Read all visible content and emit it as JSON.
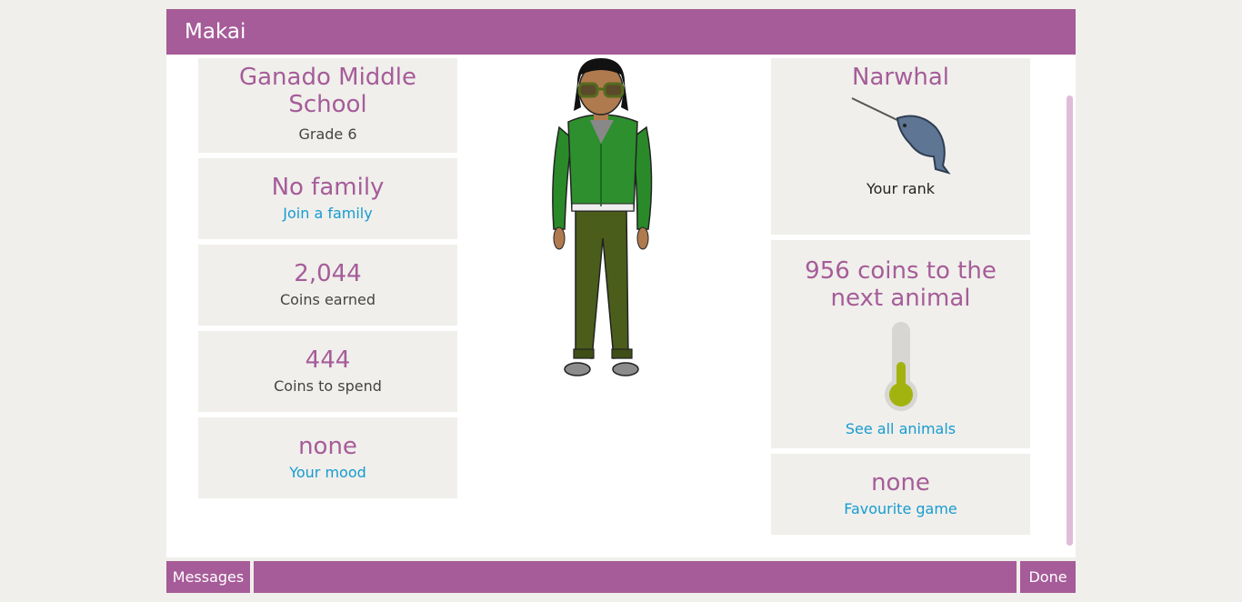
{
  "window": {
    "title": "Makai"
  },
  "left": {
    "school": {
      "name": "Ganado Middle School",
      "grade": "Grade 6"
    },
    "family": {
      "value": "No family",
      "link": "Join a family"
    },
    "earned": {
      "value": "2,044",
      "label": "Coins earned"
    },
    "spend": {
      "value": "444",
      "label": "Coins to spend"
    },
    "mood": {
      "value": "none",
      "link": "Your mood"
    }
  },
  "right": {
    "rank": {
      "animal": "Narwhal",
      "label": "Your rank"
    },
    "progress": {
      "text": "956 coins to the next animal",
      "fill_fraction": 0.45,
      "link": "See all animals"
    },
    "game": {
      "value": "none",
      "link": "Favourite game"
    }
  },
  "footer": {
    "messages": "Messages",
    "done": "Done"
  },
  "colors": {
    "accent": "#a65c99",
    "link": "#179bd1",
    "card": "#f0efeb",
    "thermometer": "#a2b30f"
  },
  "icons": {
    "avatar": "avatar-figure",
    "rank": "narwhal-icon",
    "progress": "thermometer-icon"
  }
}
